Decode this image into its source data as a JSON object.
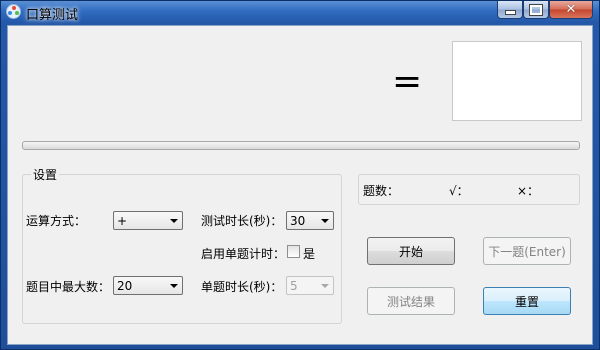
{
  "window": {
    "title": "口算测试",
    "close_glyph": "✕"
  },
  "question": {
    "equals": "="
  },
  "settings": {
    "group_title": "设置",
    "operation_label": "运算方式：",
    "operation_value": "+",
    "max_number_label": "题目中最大数：",
    "max_number_value": "20",
    "duration_label": "测试时长(秒)：",
    "duration_value": "30",
    "per_question_timer_label": "启用单题计时：",
    "per_question_timer_option": "是",
    "per_question_timer_checked": false,
    "per_question_duration_label": "单题时长(秒)：",
    "per_question_duration_value": "5",
    "per_question_duration_enabled": false
  },
  "stats": {
    "count_label": "题数：",
    "correct_label": "√：",
    "wrong_label": "×："
  },
  "buttons": {
    "start": "开始",
    "next": "下一题(Enter)",
    "result": "测试结果",
    "reset": "重置"
  },
  "progress": 0,
  "colors": {
    "titlebar": "#2458a8",
    "client_bg": "#f0f0f0",
    "progress_fill": "#4fc14c",
    "close_button": "#c4452c"
  },
  "icons": [
    "app-icon",
    "minimize-icon",
    "maximize-icon",
    "close-icon",
    "dropdown-arrow-icon"
  ]
}
